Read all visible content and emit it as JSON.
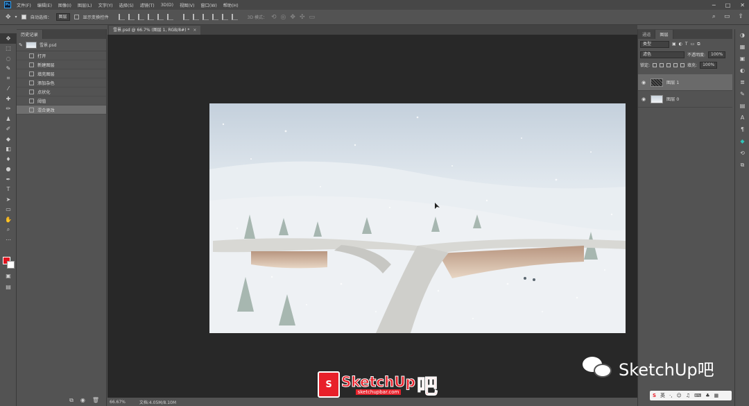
{
  "app": {
    "logo_text": "Ps"
  },
  "menu": [
    "文件(F)",
    "编辑(E)",
    "图像(I)",
    "图层(L)",
    "文字(Y)",
    "选择(S)",
    "滤镜(T)",
    "3D(D)",
    "视图(V)",
    "窗口(W)",
    "帮助(H)"
  ],
  "options": {
    "auto_select_label": "自动选择：",
    "auto_select_value": "图层",
    "show_transform_label": "显示变换控件",
    "mode_3d_label": "3D 模式："
  },
  "document": {
    "tab_title": "雪景.psd @ 66.7% (图层 1, RGB/8#) *",
    "zoom": "66.67%",
    "doc_info": "文档:4.05M/8.10M"
  },
  "history": {
    "tab_label": "历史记录",
    "snapshot_name": "雪景.psd",
    "steps": [
      "打开",
      "新建图层",
      "填充图层",
      "添加杂色",
      "点状化",
      "阈值",
      "混合更改"
    ],
    "selected_index": 6
  },
  "layers": {
    "tabs": [
      "通道",
      "图层"
    ],
    "active_tab": 1,
    "kind_filter": "类型",
    "blend_mode": "滤色",
    "opacity_label": "不透明度:",
    "opacity_value": "100%",
    "lock_label": "锁定:",
    "fill_label": "填充:",
    "fill_value": "100%",
    "items": [
      {
        "name": "图层 1",
        "selected": true
      },
      {
        "name": "图层 0",
        "selected": false
      }
    ]
  },
  "watermark": {
    "brand": "SketchUp",
    "suffix": "吧",
    "url": "sketchupbar.com",
    "wechat_name": "SketchUp吧"
  },
  "ime": {
    "lang": "英"
  },
  "colors": {
    "foreground": "#e0131e",
    "background": "#ffffff",
    "accent": "#31a8ff"
  }
}
